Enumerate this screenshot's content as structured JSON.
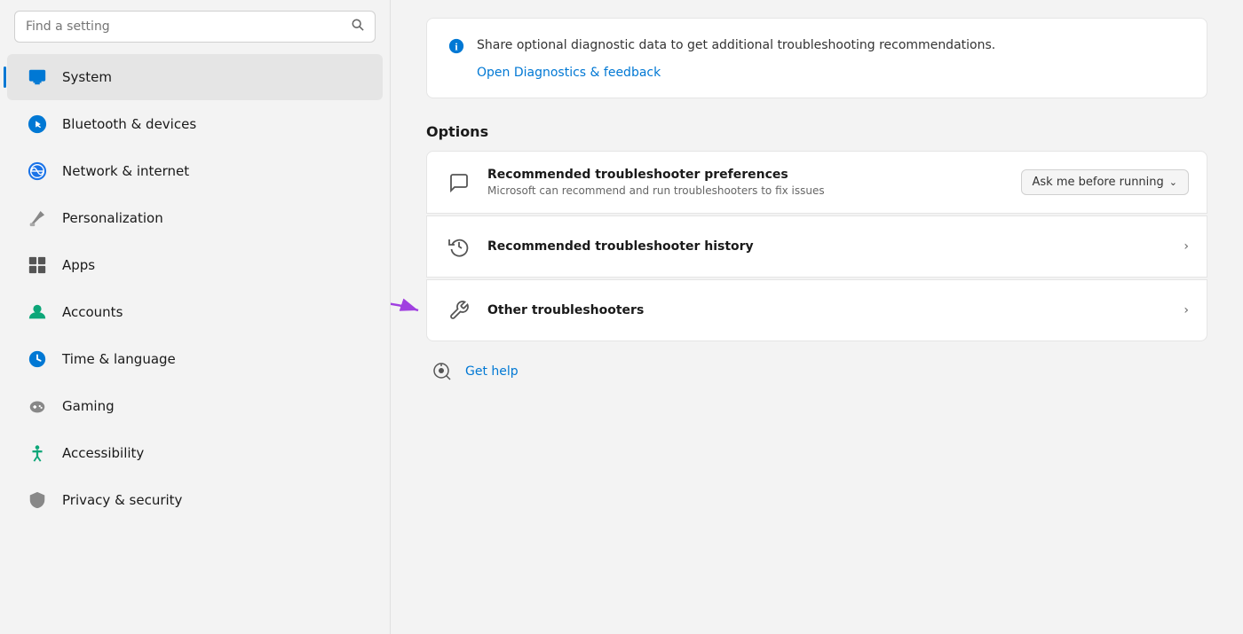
{
  "sidebar": {
    "search": {
      "placeholder": "Find a setting"
    },
    "items": [
      {
        "id": "system",
        "label": "System",
        "active": true,
        "icon": "monitor-icon"
      },
      {
        "id": "bluetooth",
        "label": "Bluetooth & devices",
        "active": false,
        "icon": "bluetooth-icon"
      },
      {
        "id": "network",
        "label": "Network & internet",
        "active": false,
        "icon": "network-icon"
      },
      {
        "id": "personalization",
        "label": "Personalization",
        "active": false,
        "icon": "brush-icon"
      },
      {
        "id": "apps",
        "label": "Apps",
        "active": false,
        "icon": "apps-icon"
      },
      {
        "id": "accounts",
        "label": "Accounts",
        "active": false,
        "icon": "accounts-icon"
      },
      {
        "id": "time",
        "label": "Time & language",
        "active": false,
        "icon": "time-icon"
      },
      {
        "id": "gaming",
        "label": "Gaming",
        "active": false,
        "icon": "gaming-icon"
      },
      {
        "id": "accessibility",
        "label": "Accessibility",
        "active": false,
        "icon": "accessibility-icon"
      },
      {
        "id": "privacy",
        "label": "Privacy & security",
        "active": false,
        "icon": "privacy-icon"
      }
    ]
  },
  "main": {
    "info_text": "Share optional diagnostic data to get additional troubleshooting recommendations.",
    "info_link_label": "Open Diagnostics & feedback",
    "options_title": "Options",
    "options": [
      {
        "id": "recommended-prefs",
        "icon": "chat-icon",
        "title": "Recommended troubleshooter preferences",
        "desc": "Microsoft can recommend and run troubleshooters to fix issues",
        "has_dropdown": true,
        "dropdown_value": "Ask me before running"
      },
      {
        "id": "troubleshooter-history",
        "icon": "history-icon",
        "title": "Recommended troubleshooter history",
        "desc": "",
        "has_dropdown": false
      },
      {
        "id": "other-troubleshooters",
        "icon": "wrench-icon",
        "title": "Other troubleshooters",
        "desc": "",
        "has_dropdown": false,
        "has_arrow": true
      }
    ],
    "get_help_label": "Get help"
  }
}
